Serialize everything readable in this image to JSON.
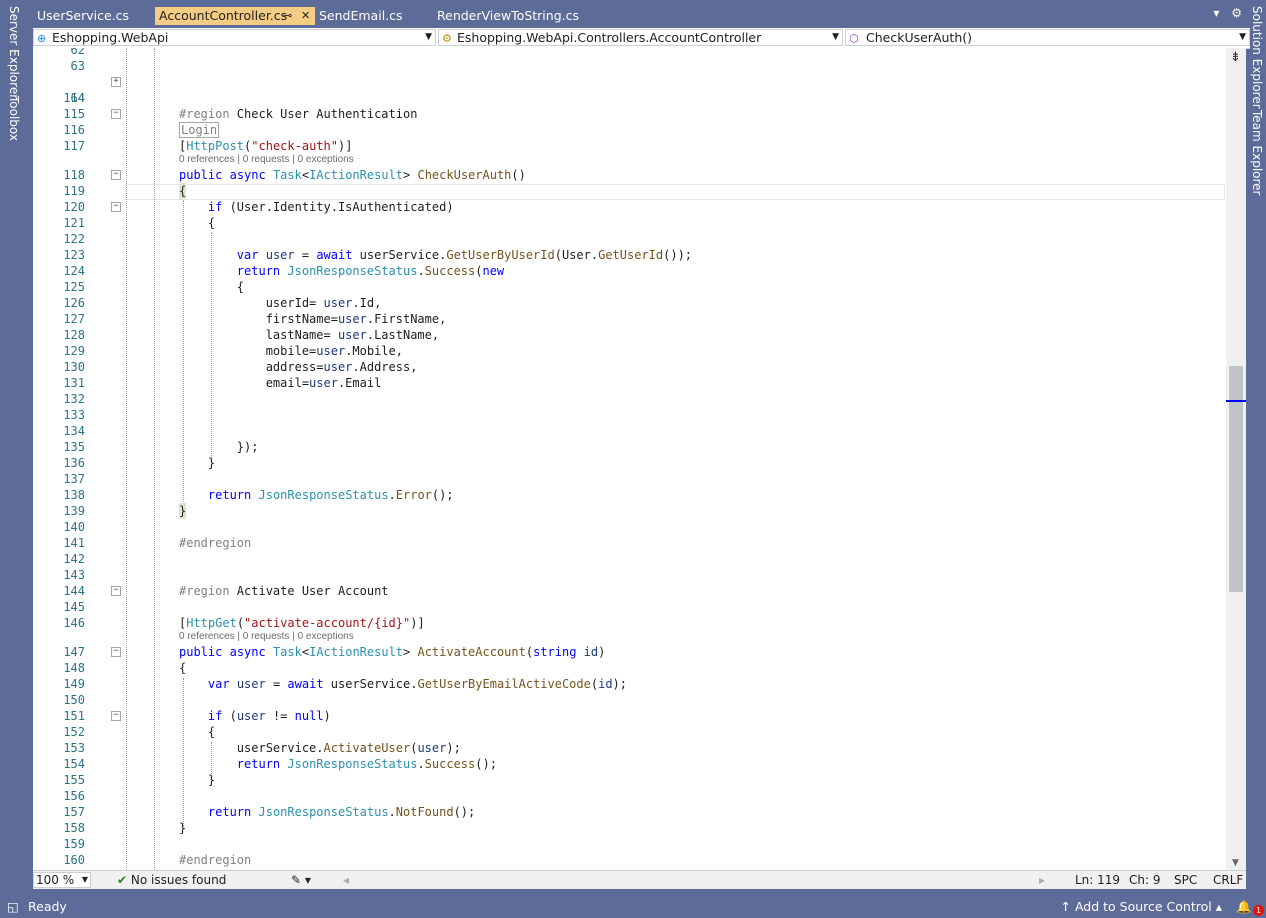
{
  "tabs": [
    {
      "label": "UserService.cs",
      "active": false
    },
    {
      "label": "AccountController.cs",
      "active": true
    },
    {
      "label": "SendEmail.cs",
      "active": false
    },
    {
      "label": "RenderViewToString.cs",
      "active": false
    }
  ],
  "side_panels": {
    "left": [
      "Server Explorer",
      "Toolbox"
    ],
    "right": [
      "Solution Explorer",
      "Team Explorer"
    ]
  },
  "navbar": {
    "project": "Eshopping.WebApi",
    "type": "Eshopping.WebApi.Controllers.AccountController",
    "member": "CheckUserAuth()"
  },
  "code": {
    "line_62": "62",
    "line_63": "63",
    "line_64": "64",
    "collapsed_login": "Login",
    "lines": [
      {
        "n": "114",
        "t": ""
      },
      {
        "n": "115",
        "t": "#region Check User Authentication"
      },
      {
        "n": "116",
        "t": ""
      },
      {
        "n": "117",
        "t": "[HttpPost(\"check-auth\")]"
      },
      {
        "n": "118",
        "t": "public async Task<IActionResult> CheckUserAuth()"
      },
      {
        "n": "119",
        "t": "{"
      },
      {
        "n": "120",
        "t": "    if (User.Identity.IsAuthenticated)"
      },
      {
        "n": "121",
        "t": "    {"
      },
      {
        "n": "122",
        "t": ""
      },
      {
        "n": "123",
        "t": "        var user = await userService.GetUserByUserId(User.GetUserId());"
      },
      {
        "n": "124",
        "t": "        return JsonResponseStatus.Success(new"
      },
      {
        "n": "125",
        "t": "        {"
      },
      {
        "n": "126",
        "t": "            userId= user.Id,"
      },
      {
        "n": "127",
        "t": "            firstName=user.FirstName,"
      },
      {
        "n": "128",
        "t": "            lastName= user.LastName,"
      },
      {
        "n": "129",
        "t": "            mobile=user.Mobile,"
      },
      {
        "n": "130",
        "t": "            address=user.Address,"
      },
      {
        "n": "131",
        "t": "            email=user.Email"
      },
      {
        "n": "132",
        "t": ""
      },
      {
        "n": "133",
        "t": ""
      },
      {
        "n": "134",
        "t": ""
      },
      {
        "n": "135",
        "t": "        });"
      },
      {
        "n": "136",
        "t": "    }"
      },
      {
        "n": "137",
        "t": ""
      },
      {
        "n": "138",
        "t": "    return JsonResponseStatus.Error();"
      },
      {
        "n": "139",
        "t": "}"
      },
      {
        "n": "140",
        "t": ""
      },
      {
        "n": "141",
        "t": "#endregion"
      },
      {
        "n": "142",
        "t": ""
      },
      {
        "n": "143",
        "t": ""
      },
      {
        "n": "144",
        "t": "#region Activate User Account"
      },
      {
        "n": "145",
        "t": ""
      },
      {
        "n": "146",
        "t": "[HttpGet(\"activate-account/{id}\")]"
      },
      {
        "n": "147",
        "t": "public async Task<IActionResult> ActivateAccount(string id)"
      },
      {
        "n": "148",
        "t": "{"
      },
      {
        "n": "149",
        "t": "    var user = await userService.GetUserByEmailActiveCode(id);"
      },
      {
        "n": "150",
        "t": ""
      },
      {
        "n": "151",
        "t": "    if (user != null)"
      },
      {
        "n": "152",
        "t": "    {"
      },
      {
        "n": "153",
        "t": "        userService.ActivateUser(user);"
      },
      {
        "n": "154",
        "t": "        return JsonResponseStatus.Success();"
      },
      {
        "n": "155",
        "t": "    }"
      },
      {
        "n": "156",
        "t": ""
      },
      {
        "n": "157",
        "t": "    return JsonResponseStatus.NotFound();"
      },
      {
        "n": "158",
        "t": "}"
      },
      {
        "n": "159",
        "t": ""
      },
      {
        "n": "160",
        "t": "#endregion"
      }
    ],
    "codelens_1": "0 references | 0 requests | 0 exceptions",
    "codelens_2": "0 references | 0 requests | 0 exceptions"
  },
  "editor_status": {
    "zoom": "100 %",
    "issues": "No issues found",
    "line": "Ln: 119",
    "col": "Ch: 9",
    "spacing": "SPC",
    "eol": "CRLF"
  },
  "statusbar": {
    "ready": "Ready",
    "source_control": "Add to Source Control",
    "notifications": "1"
  }
}
